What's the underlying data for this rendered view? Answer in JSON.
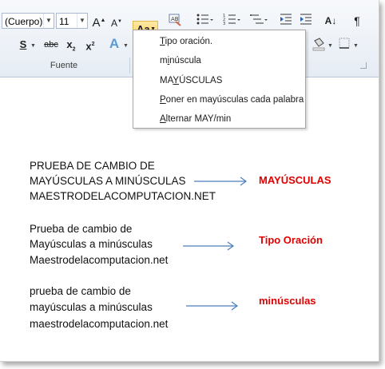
{
  "ribbon": {
    "font_name": "(Cuerpo)",
    "font_size": "11",
    "grow_font": "A",
    "shrink_font": "A",
    "change_case_label": "Aa",
    "bold": "S",
    "strikethrough": "abc",
    "subscript": "x",
    "subscript_mark": "2",
    "superscript": "x",
    "superscript_mark": "2",
    "text_effects": "A",
    "show_marks": "¶",
    "sort": "A↓",
    "group_label": "Fuente"
  },
  "change_case_menu": {
    "items": [
      {
        "mn": "T",
        "rest": "ipo oración."
      },
      {
        "pre": "m",
        "mn": "i",
        "rest": "núscula"
      },
      {
        "pre": "MA",
        "mn": "Y",
        "rest": "ÚSCULAS"
      },
      {
        "mn": "P",
        "rest": "oner en mayúsculas cada palabra"
      },
      {
        "mn": "A",
        "rest": "lternar MAY/min"
      }
    ]
  },
  "document": {
    "blocks": [
      {
        "lines": [
          "PRUEBA DE CAMBIO DE",
          "MAYÚSCULAS A MINÚSCULAS",
          "MAESTRODELACOMPUTACION.NET"
        ],
        "result": "MAYÚSCULAS"
      },
      {
        "lines": [
          "Prueba de cambio de",
          "Mayúsculas a minúsculas",
          "Maestrodelacomputacion.net"
        ],
        "result": "Tipo Oración"
      },
      {
        "lines": [
          "prueba de cambio de",
          "mayúsculas a minúsculas",
          "maestrodelacomputacion.net"
        ],
        "result": "minúsculas"
      }
    ]
  },
  "colors": {
    "accent_red": "#e00000",
    "arrow_blue": "#4a7ebb",
    "highlight_yellow": "#ffd35d"
  }
}
